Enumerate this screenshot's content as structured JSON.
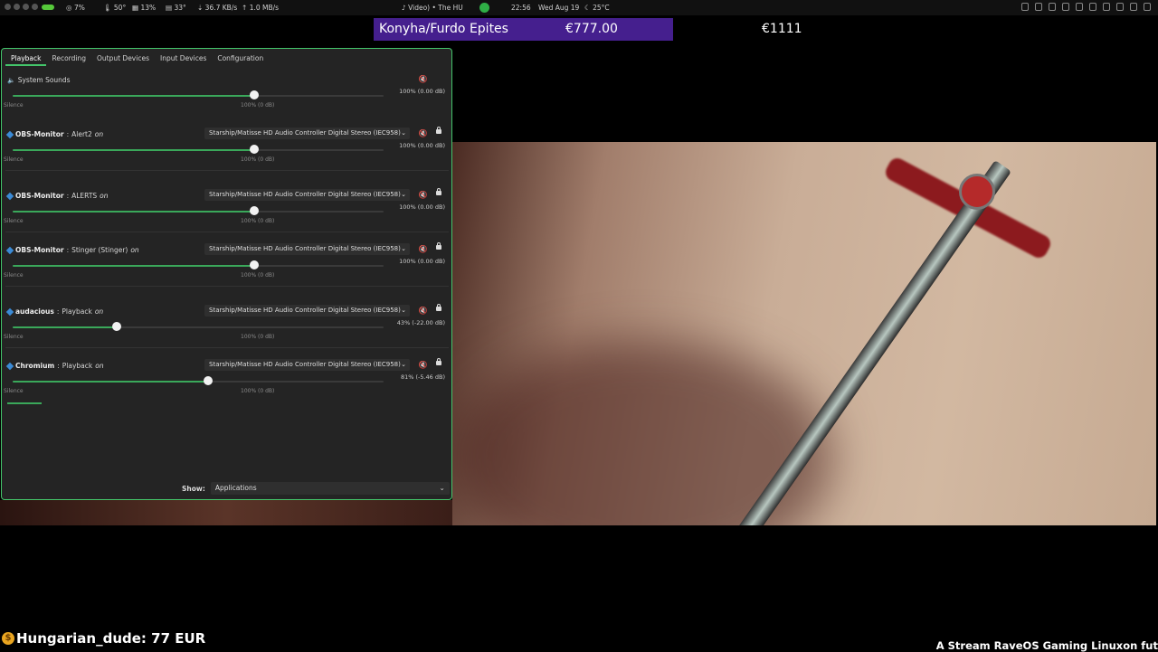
{
  "topbar": {
    "cpu": "7%",
    "cpu_temp": "50°",
    "mem": "13%",
    "gpu_temp": "33°",
    "net_down": "36.7 KB/s",
    "net_up": "1.0 MB/s",
    "media": "Video) • The HU",
    "time": "22:56",
    "date": "Wed Aug 19",
    "weather": "25°C"
  },
  "overlay": {
    "donor": "Konyha/Furdo Epites",
    "amount": "€777.00",
    "goal": "€1111",
    "chat": "Hungarian_dude: 77 EUR",
    "chat_icon": "$",
    "ticker": "A Stream RaveOS Gaming Linuxon fut"
  },
  "mixer": {
    "tabs": [
      "Playback",
      "Recording",
      "Output Devices",
      "Input Devices",
      "Configuration"
    ],
    "system": {
      "name": "System Sounds",
      "percent": "100% (0.00 dB)",
      "level": 1.0
    },
    "silence_label": "Silence",
    "hundred_label": "100% (0 dB)",
    "streams": [
      {
        "app": "OBS-Monitor",
        "sep": " : ",
        "title": "Alert2",
        "state": "on",
        "device": "Starship/Matisse HD Audio Controller Digital Stereo (IEC958)",
        "percent": "100% (0.00 dB)",
        "level": 1.0
      },
      {
        "app": "OBS-Monitor",
        "sep": " : ",
        "title": "ALERTS",
        "state": "on",
        "device": "Starship/Matisse HD Audio Controller Digital Stereo (IEC958)",
        "percent": "100% (0.00 dB)",
        "level": 1.0
      },
      {
        "app": "OBS-Monitor",
        "sep": " : ",
        "title": "Stinger (Stinger)",
        "state": "on",
        "device": "Starship/Matisse HD Audio Controller Digital Stereo (IEC958)",
        "percent": "100% (0.00 dB)",
        "level": 1.0
      },
      {
        "app": "audacious",
        "sep": " : ",
        "title": "Playback",
        "state": "on",
        "device": "Starship/Matisse HD Audio Controller Digital Stereo (IEC958)",
        "percent": "43% (-22.00 dB)",
        "level": 0.43
      },
      {
        "app": "Chromium",
        "sep": " : ",
        "title": "Playback",
        "state": "on",
        "device": "Starship/Matisse HD Audio Controller Digital Stereo (IEC958)",
        "percent": "81% (-5.46 dB)",
        "level": 0.81
      }
    ],
    "show_label": "Show:",
    "show_value": "Applications"
  }
}
